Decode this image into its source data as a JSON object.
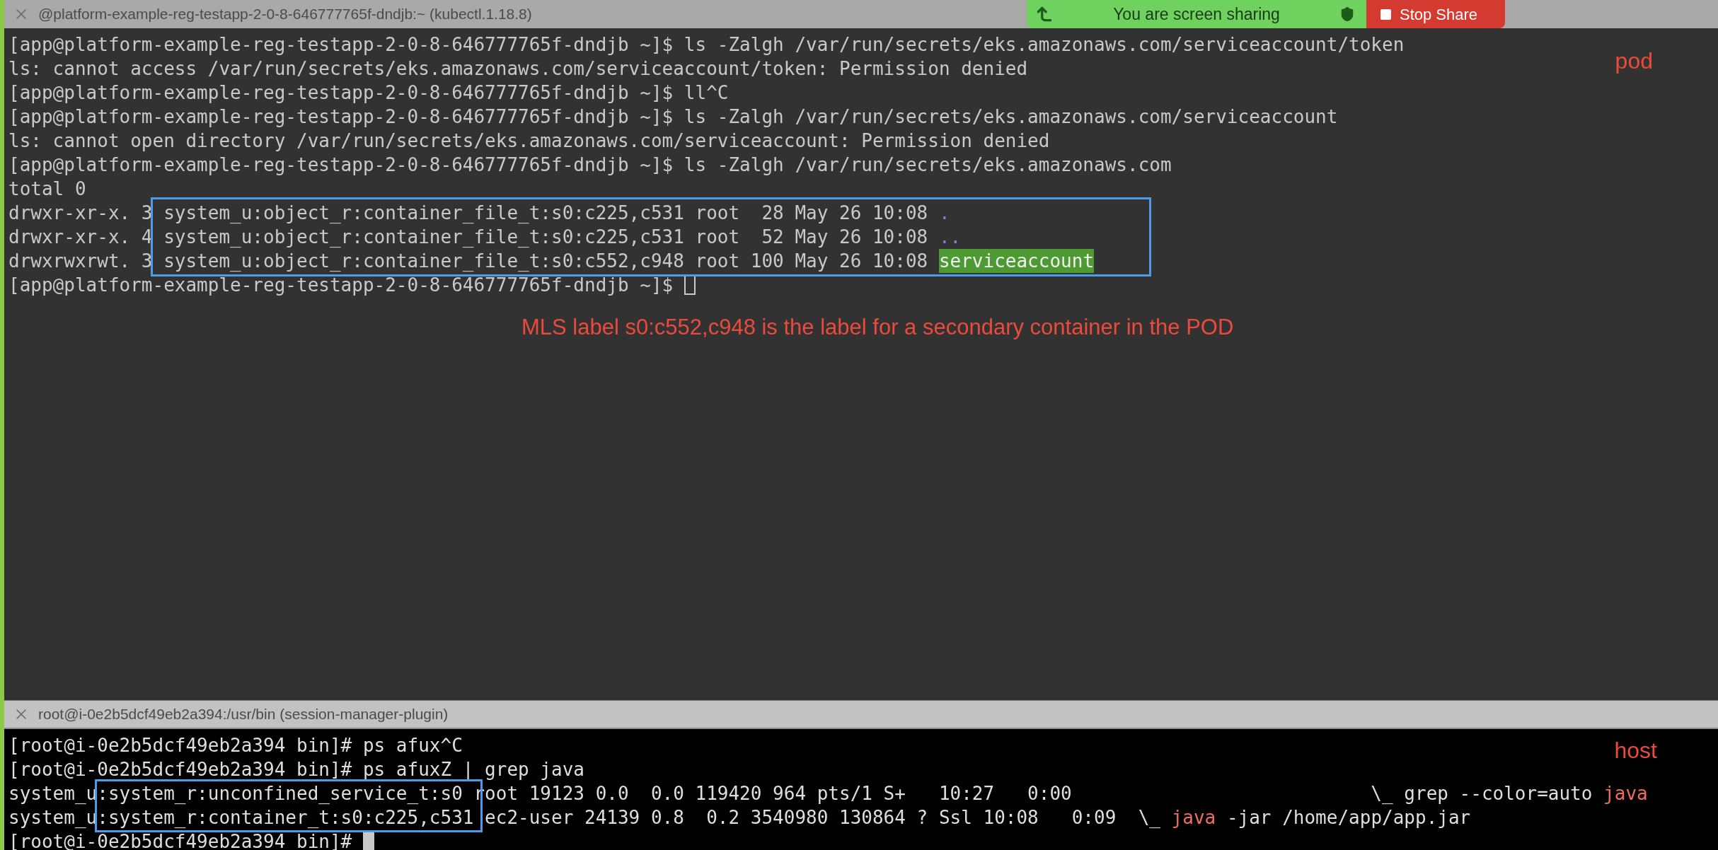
{
  "screen_share": {
    "status": "You are screen sharing",
    "button": "Stop Share"
  },
  "terminals": [
    {
      "title": "@platform-example-reg-testapp-2-0-8-646777765f-dndjb:~ (kubectl.1.18.8)",
      "focused": false,
      "label": "pod",
      "note": "MLS label s0:c552,c948 is the label for a secondary container in the POD",
      "lines": [
        [
          {
            "kind": "text",
            "text": "[app@platform-example-reg-testapp-2-0-8-646777765f-dndjb ~]$ ls -Zalgh /var/run/secrets/eks.amazonaws.com/serviceaccount/token"
          }
        ],
        [
          {
            "kind": "text",
            "text": "ls: cannot access /var/run/secrets/eks.amazonaws.com/serviceaccount/token: Permission denied"
          }
        ],
        [
          {
            "kind": "text",
            "text": "[app@platform-example-reg-testapp-2-0-8-646777765f-dndjb ~]$ ll^C"
          }
        ],
        [
          {
            "kind": "text",
            "text": "[app@platform-example-reg-testapp-2-0-8-646777765f-dndjb ~]$ ls -Zalgh /var/run/secrets/eks.amazonaws.com/serviceaccount"
          }
        ],
        [
          {
            "kind": "text",
            "text": "ls: cannot open directory /var/run/secrets/eks.amazonaws.com/serviceaccount: Permission denied"
          }
        ],
        [
          {
            "kind": "text",
            "text": "[app@platform-example-reg-testapp-2-0-8-646777765f-dndjb ~]$ ls -Zalgh /var/run/secrets/eks.amazonaws.com"
          }
        ],
        [
          {
            "kind": "text",
            "text": "total 0"
          }
        ],
        [
          {
            "kind": "text",
            "text": "drwxr-xr-x. 3 system_u:object_r:container_file_t:s0:c225,c531 root  28 May 26 10:08 "
          },
          {
            "kind": "dir",
            "text": "."
          }
        ],
        [
          {
            "kind": "text",
            "text": "drwxr-xr-x. 4 system_u:object_r:container_file_t:s0:c225,c531 root  52 May 26 10:08 "
          },
          {
            "kind": "dir",
            "text": ".."
          }
        ],
        [
          {
            "kind": "text",
            "text": "drwxrwxrwt. 3 system_u:object_r:container_file_t:s0:c552,c948 root 100 May 26 10:08 "
          },
          {
            "kind": "highlight",
            "text": "serviceaccount"
          }
        ],
        [
          {
            "kind": "text",
            "text": "[app@platform-example-reg-testapp-2-0-8-646777765f-dndjb ~]$ "
          }
        ]
      ]
    },
    {
      "title": "root@i-0e2b5dcf49eb2a394:/usr/bin (session-manager-plugin)",
      "focused": true,
      "label": "host",
      "lines": [
        [
          {
            "kind": "text",
            "text": "[root@i-0e2b5dcf49eb2a394 bin]# ps afux^C"
          }
        ],
        [
          {
            "kind": "text",
            "text": "[root@i-0e2b5dcf49eb2a394 bin]# ps afuxZ | grep java"
          }
        ],
        [
          {
            "kind": "text",
            "text": "system_u:system_r:unconfined_service_t:s0 root 19123 0.0  0.0 119420 964 pts/1 S+   10:27   0:00                           \\_ grep --color=auto "
          },
          {
            "kind": "match",
            "text": "java"
          }
        ],
        [
          {
            "kind": "text",
            "text": "system_u:system_r:container_t:s0:c225,c531 ec2-user 24139 0.8  0.2 3540980 130864 ? Ssl 10:08   0:09  \\_ "
          },
          {
            "kind": "match",
            "text": "java"
          },
          {
            "kind": "text",
            "text": " -jar /home/app/app.jar"
          }
        ],
        [
          {
            "kind": "text",
            "text": "[root@i-0e2b5dcf49eb2a394 bin]# "
          }
        ]
      ]
    }
  ]
}
